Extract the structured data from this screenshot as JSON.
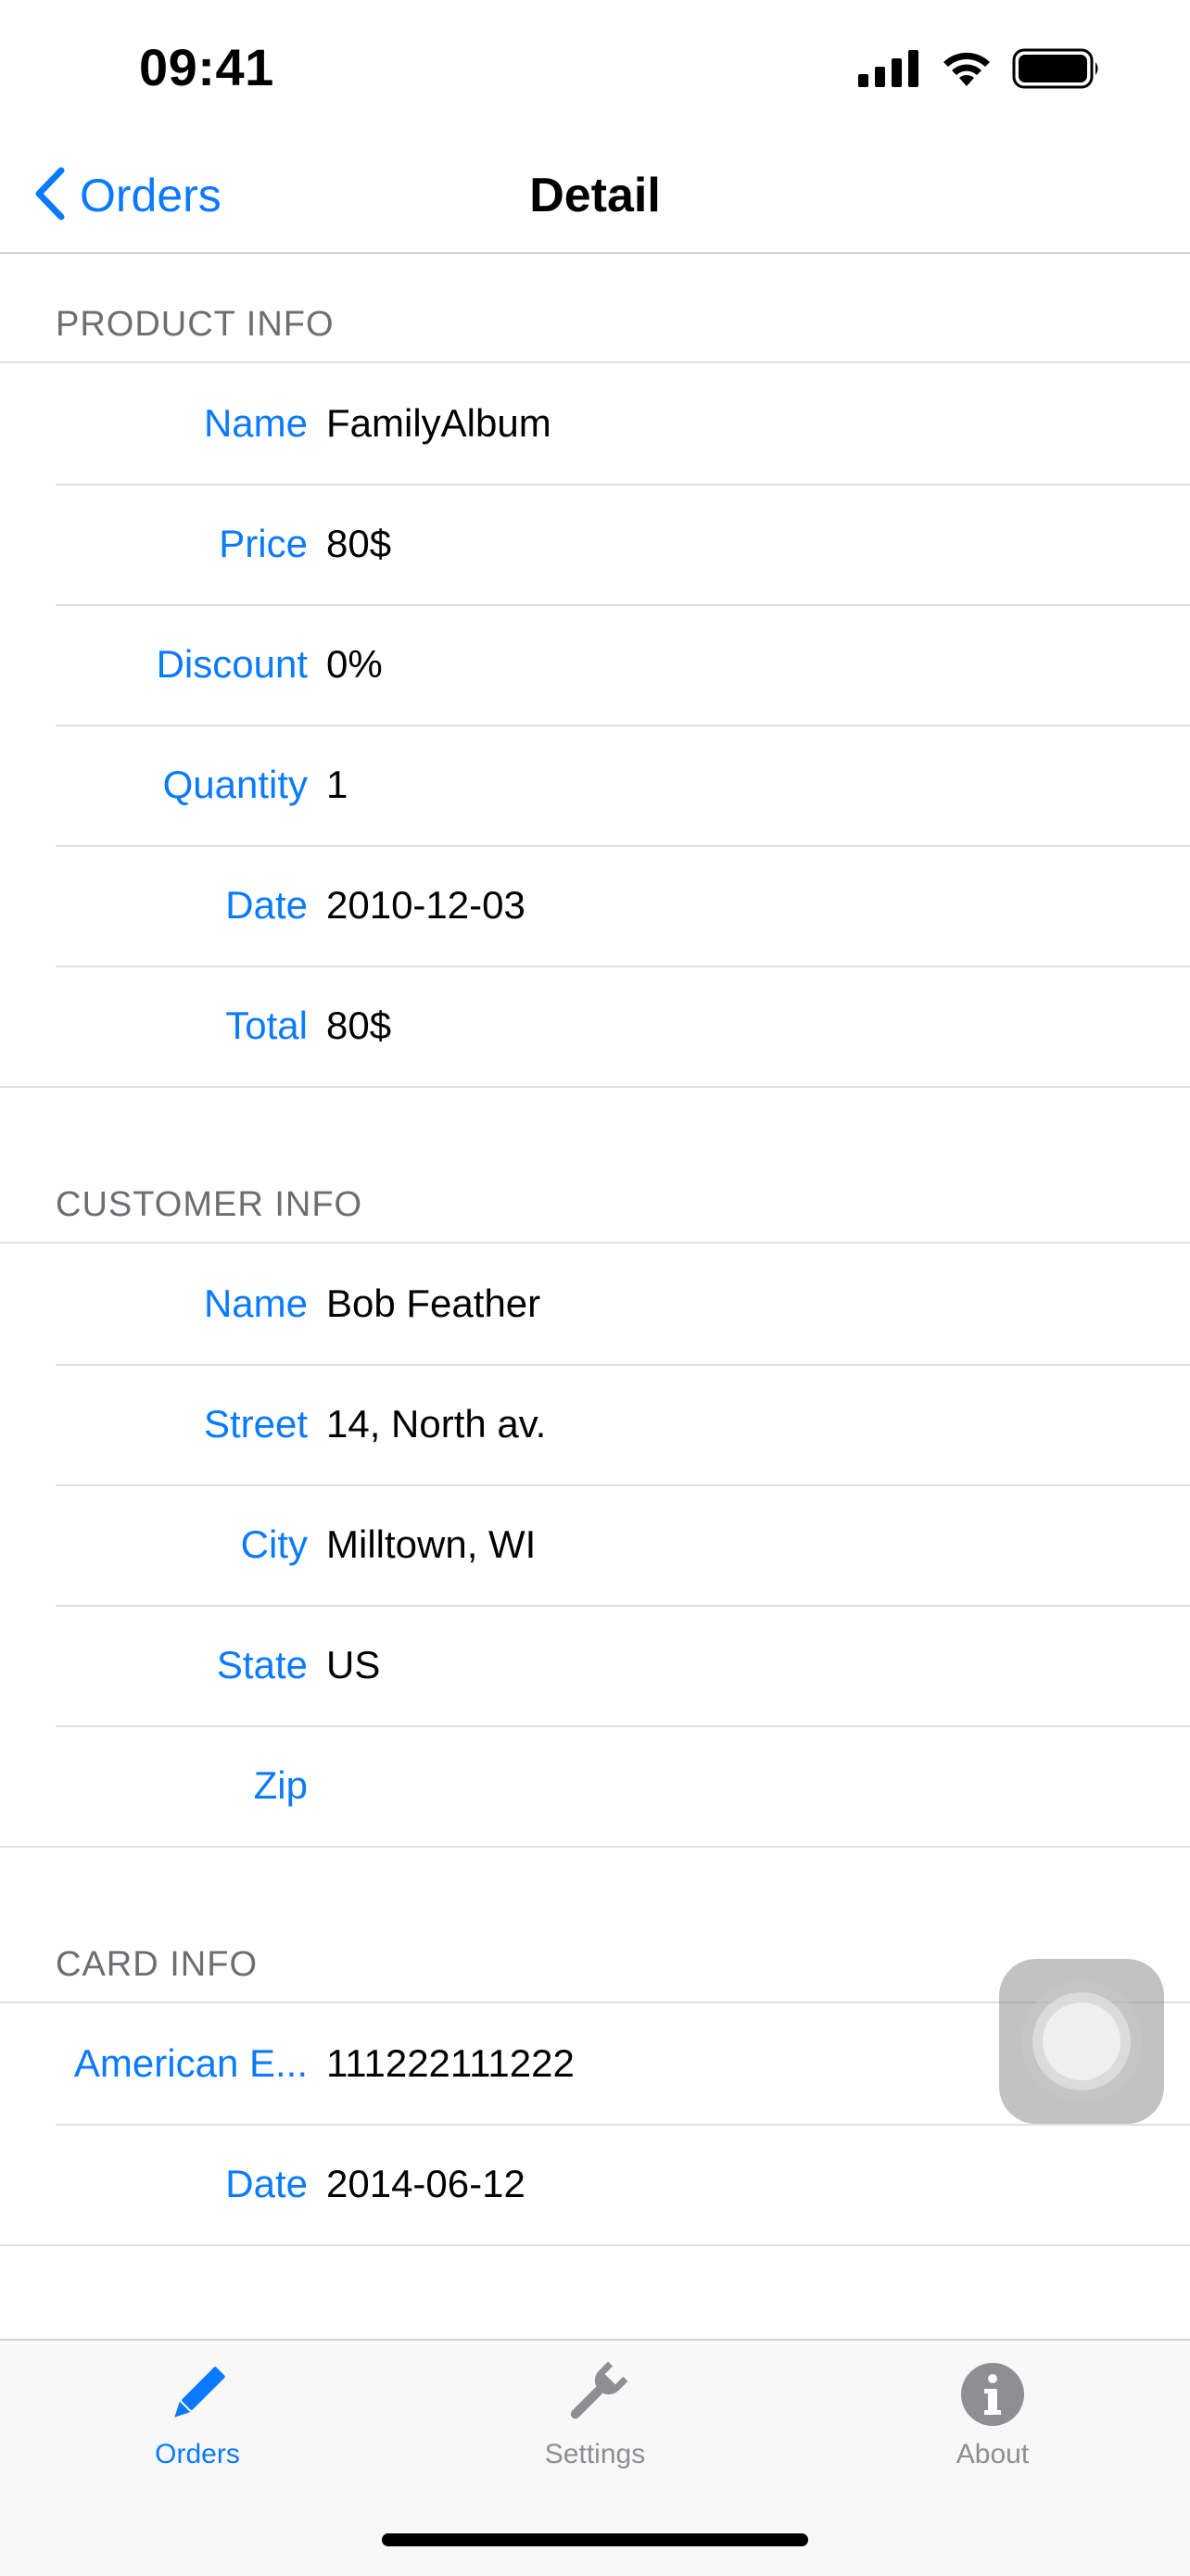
{
  "status_bar": {
    "time": "09:41"
  },
  "nav": {
    "back_label": "Orders",
    "title": "Detail"
  },
  "sections": [
    {
      "header": "PRODUCT INFO",
      "rows": [
        {
          "label": "Name",
          "value": "FamilyAlbum"
        },
        {
          "label": "Price",
          "value": "80$"
        },
        {
          "label": "Discount",
          "value": "0%"
        },
        {
          "label": "Quantity",
          "value": "1"
        },
        {
          "label": "Date",
          "value": "2010-12-03"
        },
        {
          "label": "Total",
          "value": "80$"
        }
      ]
    },
    {
      "header": "CUSTOMER INFO",
      "rows": [
        {
          "label": "Name",
          "value": "Bob Feather"
        },
        {
          "label": "Street",
          "value": "14, North av."
        },
        {
          "label": "City",
          "value": "Milltown, WI"
        },
        {
          "label": "State",
          "value": "US"
        },
        {
          "label": "Zip",
          "value": ""
        }
      ]
    },
    {
      "header": "CARD INFO",
      "rows": [
        {
          "label": "American E...",
          "value": "111222111222"
        },
        {
          "label": "Date",
          "value": "2014-06-12"
        }
      ]
    }
  ],
  "tabs": [
    {
      "label": "Orders",
      "icon": "pencil-icon",
      "active": true
    },
    {
      "label": "Settings",
      "icon": "wrench-icon",
      "active": false
    },
    {
      "label": "About",
      "icon": "info-icon",
      "active": false
    }
  ],
  "colors": {
    "accent": "#0a7aff",
    "secondary_text": "#6d6d72",
    "inactive_tab": "#8e8e93"
  }
}
